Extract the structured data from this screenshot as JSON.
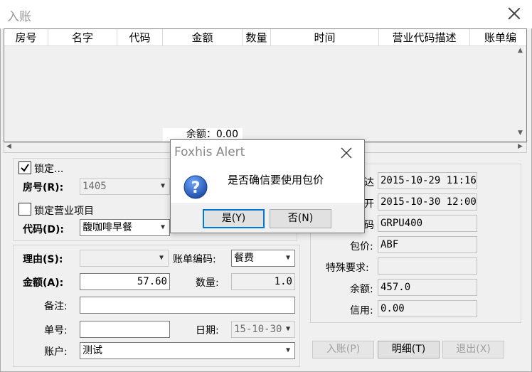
{
  "window": {
    "title": "入账"
  },
  "grid": {
    "columns": [
      "房号",
      "名字",
      "代码",
      "金额",
      "数量",
      "时间",
      "营业代码描述",
      "账单编"
    ],
    "sum_text": "余额：0.00"
  },
  "left": {
    "lock_label": "锁定...",
    "lock_checked": true,
    "room_label": "房号(R):",
    "room_value": "1405",
    "lock_business_label": "锁定营业项目",
    "lock_business_checked": false,
    "code_label": "代码(D):",
    "code_value": "馥咖啡早餐",
    "reason_label": "理由(S):",
    "reason_value": "",
    "bill_code_label": "账单编码:",
    "bill_code_value": "餐费",
    "amount_label": "金额(A):",
    "amount_value": "57.60",
    "qty_label": "数量:",
    "qty_value": "1.0",
    "note_label": "备注:",
    "note_value": "",
    "doc_no_label": "单号:",
    "doc_no_value": "",
    "date_label": "日期:",
    "date_value": "15-10-30",
    "account_label": "账户:",
    "account_value": "测试"
  },
  "right": {
    "arrive_label": "达",
    "arrive_value": "2015-10-29 11:16",
    "depart_label": "开",
    "depart_value": "2015-10-30 12:00",
    "rate_code_label": "码",
    "rate_code_value": "GRPU400",
    "package_label": "包价:",
    "package_value": "ABF",
    "special_label": "特殊要求:",
    "special_value": "",
    "balance_label": "余额:",
    "balance_value": "457.0",
    "credit_label": "信用:",
    "credit_value": "0.00"
  },
  "buttons": {
    "post": "入账(P)",
    "detail": "明细(T)",
    "exit": "退出(X)"
  },
  "dialog": {
    "title": "Foxhis Alert",
    "icon": "question-icon",
    "message": "是否确信要使用包价",
    "yes": "是(Y)",
    "no": "否(N)"
  },
  "colors": {
    "accent": "#0078d7",
    "question_icon": "#1f5fbf"
  }
}
